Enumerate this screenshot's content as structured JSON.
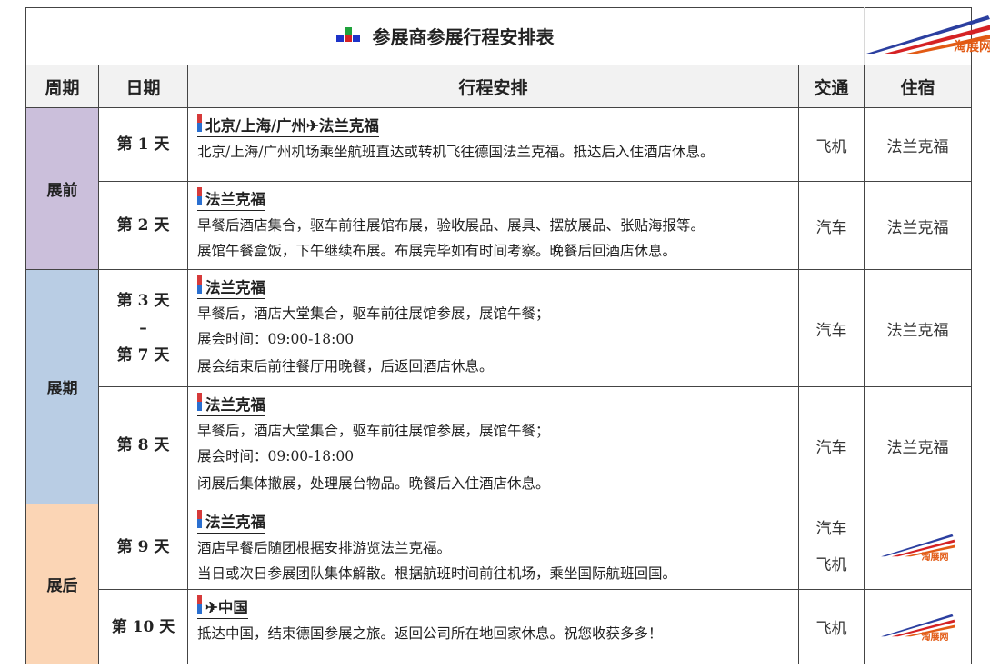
{
  "header": {
    "title": "参展商参展行程安排表",
    "logo_text": "淘展网",
    "columns": [
      "周期",
      "日期",
      "行程安排",
      "交通",
      "住宿"
    ]
  },
  "icons": {
    "title_icon": "four-color-squares-icon",
    "section_marker": "red-blue-bar-icon",
    "logo": "taozhanwang-swoosh-logo",
    "colors": {
      "pre_show": "#cbbfdb",
      "show": "#b9cde4",
      "post_show": "#fbd5b5",
      "logo_orange": "#e25a14",
      "logo_blue": "#2b3fa0",
      "logo_red": "#d52224"
    }
  },
  "periods": [
    {
      "label": "展前"
    },
    {
      "label": "展期"
    },
    {
      "label": "展后"
    }
  ],
  "rows": [
    {
      "day": [
        "第 1 天"
      ],
      "heading": "北京/上海/广州✈法兰克福",
      "lines": [
        "北京/上海/广州机场乘坐航班直达或转机飞往德国法兰克福。抵达后入住酒店休息。"
      ],
      "transport": [
        "飞机"
      ],
      "hotel": "法兰克福"
    },
    {
      "day": [
        "第 2 天"
      ],
      "heading": "法兰克福",
      "lines": [
        "早餐后酒店集合，驱车前往展馆布展，验收展品、展具、摆放展品、张贴海报等。",
        "展馆午餐盒饭，下午继续布展。布展完毕如有时间考察。晚餐后回酒店休息。"
      ],
      "transport": [
        "汽车"
      ],
      "hotel": "法兰克福"
    },
    {
      "day": [
        "第 3 天",
        "–",
        "第 7 天"
      ],
      "heading": "法兰克福",
      "lines": [
        "早餐后，酒店大堂集合，驱车前往展馆参展，展馆午餐；",
        "展会时间：09:00-18:00",
        "展会结束后前往餐厅用晚餐，后返回酒店休息。"
      ],
      "transport": [
        "汽车"
      ],
      "hotel": "法兰克福"
    },
    {
      "day": [
        "第 8 天"
      ],
      "heading": "法兰克福",
      "lines": [
        "早餐后，酒店大堂集合，驱车前往展馆参展，展馆午餐；",
        "展会时间：09:00-18:00",
        "闭展后集体撤展，处理展台物品。晚餐后入住酒店休息。"
      ],
      "transport": [
        "汽车"
      ],
      "hotel": "法兰克福"
    },
    {
      "day": [
        "第 9 天"
      ],
      "heading": "法兰克福",
      "lines": [
        "酒店早餐后随团根据安排游览法兰克福。",
        "当日或次日参展团队集体解散。根据航班时间前往机场，乘坐国际航班回国。"
      ],
      "transport": [
        "汽车",
        "飞机"
      ],
      "hotel": ""
    },
    {
      "day": [
        "第 10 天"
      ],
      "heading": "✈中国",
      "lines": [
        "抵达中国，结束德国参展之旅。返回公司所在地回家休息。祝您收获多多！"
      ],
      "transport": [
        "飞机"
      ],
      "hotel": ""
    }
  ]
}
